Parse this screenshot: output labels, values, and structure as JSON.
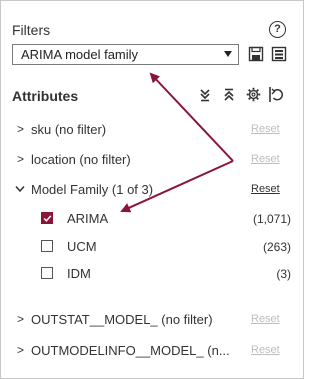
{
  "header": {
    "title": "Filters",
    "help_icon": "question-circle-icon"
  },
  "filter_select": {
    "value": "ARIMA model family"
  },
  "attributes": {
    "title": "Attributes"
  },
  "accent_color": "#8a1538",
  "annotation_color": "#8a1538",
  "rows": [
    {
      "label": "sku (no filter)",
      "reset": "Reset"
    },
    {
      "label": "location (no filter)",
      "reset": "Reset"
    },
    {
      "label": "Model Family (1 of 3)",
      "reset": "Reset"
    },
    {
      "label": "OUTSTAT__MODEL_ (no filter)",
      "reset": "Reset"
    },
    {
      "label": "OUTMODELINFO__MODEL_ (n...",
      "reset": "Reset"
    }
  ],
  "model_family_options": [
    {
      "label": "ARIMA",
      "count": "(1,071)",
      "checked": true
    },
    {
      "label": "UCM",
      "count": "(263)",
      "checked": false
    },
    {
      "label": "IDM",
      "count": "(3)",
      "checked": false
    }
  ]
}
